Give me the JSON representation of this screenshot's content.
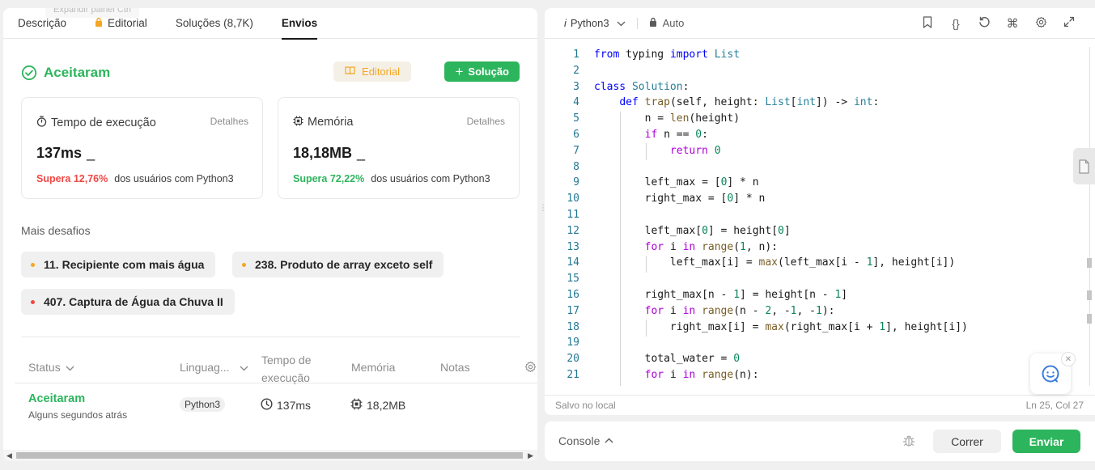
{
  "left": {
    "ghost_tip": "Expandir painel   Ctrl",
    "tabs": [
      {
        "label": "Descrição"
      },
      {
        "label": "Editorial",
        "icon": "lock-icon"
      },
      {
        "label": "Soluções (8,7K)"
      },
      {
        "label": "Envios",
        "active": true
      }
    ],
    "result": {
      "status": "Aceitaram",
      "editorial_button": "Editorial",
      "solution_button": "Solução"
    },
    "runtime": {
      "label": "Tempo de execução",
      "details": "Detalhes",
      "value": "137ms",
      "cursor": "_",
      "beats_pct": "Supera 12,76%",
      "beats_text": "dos usuários com Python3"
    },
    "memory": {
      "label": "Memória",
      "details": "Detalhes",
      "value": "18,18MB",
      "cursor": "_",
      "beats_pct": "Supera 72,22%",
      "beats_text": "dos usuários com Python3"
    },
    "more_challenges": {
      "title": "Mais desafios",
      "items": [
        {
          "label": "11. Recipiente com mais água",
          "color": "#f5a623"
        },
        {
          "label": "238. Produto de array exceto self",
          "color": "#f5a623"
        },
        {
          "label": "407. Captura de Água da Chuva II",
          "color": "#ef4743"
        }
      ]
    },
    "table": {
      "headers": {
        "status": "Status",
        "language": "Linguag...",
        "runtime_line1": "Tempo de",
        "runtime_line2": "execução",
        "memory": "Memória",
        "notes": "Notas"
      },
      "row": {
        "status": "Aceitaram",
        "time_ago": "Alguns segundos atrás",
        "language": "Python3",
        "runtime": "137ms",
        "memory": "18,2MB"
      }
    }
  },
  "editor": {
    "language": "Python3",
    "lang_prefix": "i",
    "mode": "Auto",
    "footer_saved": "Salvo no local",
    "footer_position": "Ln 25, Col 27",
    "lines": [
      {
        "n": "1",
        "code": "from typing import List"
      },
      {
        "n": "2",
        "code": ""
      },
      {
        "n": "3",
        "code": "class Solution:"
      },
      {
        "n": "4",
        "code": "    def trap(self, height: List[int]) -> int:"
      },
      {
        "n": "5",
        "code": "        n = len(height)"
      },
      {
        "n": "6",
        "code": "        if n == 0:"
      },
      {
        "n": "7",
        "code": "            return 0"
      },
      {
        "n": "8",
        "code": ""
      },
      {
        "n": "9",
        "code": "        left_max = [0] * n"
      },
      {
        "n": "10",
        "code": "        right_max = [0] * n"
      },
      {
        "n": "11",
        "code": ""
      },
      {
        "n": "12",
        "code": "        left_max[0] = height[0]"
      },
      {
        "n": "13",
        "code": "        for i in range(1, n):"
      },
      {
        "n": "14",
        "code": "            left_max[i] = max(left_max[i - 1], height[i])"
      },
      {
        "n": "15",
        "code": ""
      },
      {
        "n": "16",
        "code": "        right_max[n - 1] = height[n - 1]"
      },
      {
        "n": "17",
        "code": "        for i in range(n - 2, -1, -1):"
      },
      {
        "n": "18",
        "code": "            right_max[i] = max(right_max[i + 1], height[i])"
      },
      {
        "n": "19",
        "code": ""
      },
      {
        "n": "20",
        "code": "        total_water = 0"
      },
      {
        "n": "21",
        "code": "        for i in range(n):"
      }
    ]
  },
  "console": {
    "label": "Console",
    "run": "Correr",
    "submit": "Enviar"
  },
  "colors": {
    "accent_green": "#2db55d",
    "editorial_orange": "#f5a623",
    "beats_red": "#ef4743"
  }
}
